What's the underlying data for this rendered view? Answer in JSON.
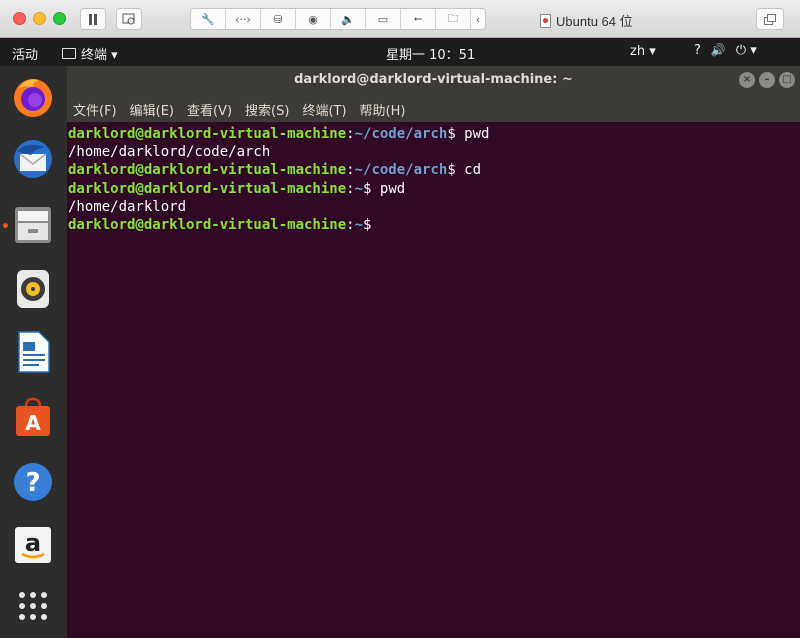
{
  "mac": {
    "window_title": "Ubuntu 64 位",
    "toolbar_icons": [
      "wrench-icon",
      "code-icon",
      "drive-icon",
      "webcam-icon",
      "speaker-icon",
      "camera-icon",
      "usb-icon",
      "folder-share-icon",
      "chevron-left-icon"
    ]
  },
  "topbar": {
    "activities": "活动",
    "app_menu": "终端 ▾",
    "clock": "星期一 10：51",
    "lang": "zh ▾",
    "accessibility": "?",
    "volume": "🔊",
    "power": "⏻ ▾"
  },
  "dock": {
    "apps": [
      "firefox",
      "thunderbird",
      "files",
      "rhythmbox",
      "libreoffice-writer",
      "software-center",
      "help",
      "amazon",
      "show-apps"
    ]
  },
  "terminal": {
    "title": "darklord@darklord-virtual-machine: ~",
    "menu": [
      "文件(F)",
      "编辑(E)",
      "查看(V)",
      "搜索(S)",
      "终端(T)",
      "帮助(H)"
    ],
    "lines": [
      {
        "user": "darklord@darklord-virtual-machine",
        "path": "~/code/arch",
        "cmd": "$ pwd"
      },
      {
        "output": "/home/darklord/code/arch"
      },
      {
        "user": "darklord@darklord-virtual-machine",
        "path": "~/code/arch",
        "cmd": "$ cd"
      },
      {
        "user": "darklord@darklord-virtual-machine",
        "path": "~",
        "cmd": "$ pwd"
      },
      {
        "output": "/home/darklord"
      },
      {
        "user": "darklord@darklord-virtual-machine",
        "path": "~",
        "cmd": "$ "
      }
    ]
  },
  "colors": {
    "terminal_bg": "#300a24",
    "prompt_user": "#8ae234",
    "prompt_path": "#729fcf",
    "ubuntu_orange": "#e95420"
  }
}
